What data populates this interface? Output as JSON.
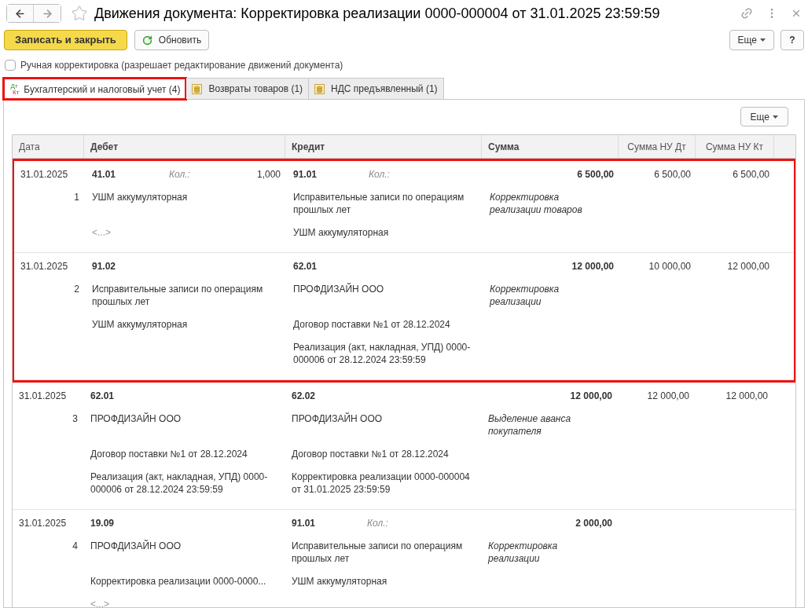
{
  "window": {
    "title": "Движения документа: Корректировка реализации 0000-000004 от 31.01.2025 23:59:59"
  },
  "toolbar": {
    "primary": "Записать и закрыть",
    "refresh": "Обновить",
    "more": "Еще",
    "help": "?"
  },
  "manual_edit": {
    "label": "Ручная корректировка (разрешает редактирование движений документа)",
    "checked": false
  },
  "tabs": [
    {
      "kind": "accounts",
      "icon_top": "Дт",
      "icon_bottom": "Кт",
      "label": "Бухгалтерский и налоговый учет (4)",
      "selected": true,
      "highlighted": true
    },
    {
      "kind": "register",
      "label": "Возвраты товаров (1)",
      "selected": false,
      "highlighted": false
    },
    {
      "kind": "register",
      "label": "НДС предъявленный (1)",
      "selected": false,
      "highlighted": false
    }
  ],
  "panel_more": "Еще",
  "table": {
    "columns": [
      "Дата",
      "Дебет",
      "Кредит",
      "Сумма",
      "Сумма НУ Дт",
      "Сумма НУ Кт"
    ],
    "entries": [
      {
        "date": "31.01.2025",
        "number": "1",
        "highlighted": true,
        "debit": {
          "account": "41.01",
          "qty_label": "Кол.:",
          "qty": "1,000"
        },
        "credit": {
          "account": "91.01",
          "qty_label": "Кол.:"
        },
        "amount": "6 500,00",
        "nu_dt": "6 500,00",
        "nu_kt": "6 500,00",
        "lines": [
          {
            "debit": "УШМ аккумуляторная",
            "credit": "Исправительные записи по операциям прошлых лет",
            "note": "Корректировка реализации товаров"
          },
          {
            "debit": "<...>",
            "debit_muted": true,
            "credit": "УШМ аккумуляторная"
          }
        ]
      },
      {
        "date": "31.01.2025",
        "number": "2",
        "highlighted": true,
        "debit": {
          "account": "91.02"
        },
        "credit": {
          "account": "62.01"
        },
        "amount": "12 000,00",
        "nu_dt": "10 000,00",
        "nu_kt": "12 000,00",
        "lines": [
          {
            "debit": "Исправительные записи по операциям прошлых лет",
            "credit": "ПРОФДИЗАЙН ООО",
            "note": "Корректировка реализации"
          },
          {
            "debit": "УШМ аккумуляторная",
            "credit": "Договор поставки №1 от 28.12.2024"
          },
          {
            "credit": "Реализация (акт, накладная, УПД) 0000-000006 от 28.12.2024 23:59:59"
          }
        ]
      },
      {
        "date": "31.01.2025",
        "number": "3",
        "highlighted": false,
        "debit": {
          "account": "62.01"
        },
        "credit": {
          "account": "62.02"
        },
        "amount": "12 000,00",
        "nu_dt": "12 000,00",
        "nu_kt": "12 000,00",
        "lines": [
          {
            "debit": "ПРОФДИЗАЙН ООО",
            "credit": "ПРОФДИЗАЙН ООО",
            "note": "Выделение аванса покупателя"
          },
          {
            "debit": "Договор поставки №1 от 28.12.2024",
            "credit": "Договор поставки №1 от 28.12.2024"
          },
          {
            "debit": "Реализация (акт, накладная, УПД) 0000-000006 от 28.12.2024 23:59:59",
            "credit": "Корректировка реализации 0000-000004 от 31.01.2025 23:59:59"
          }
        ]
      },
      {
        "date": "31.01.2025",
        "number": "4",
        "highlighted": false,
        "debit": {
          "account": "19.09"
        },
        "credit": {
          "account": "91.01",
          "qty_label": "Кол.:"
        },
        "amount": "2 000,00",
        "lines": [
          {
            "debit": "ПРОФДИЗАЙН ООО",
            "credit": "Исправительные записи по операциям прошлых лет",
            "note": "Корректировка реализации"
          },
          {
            "debit": "Корректировка реализации 0000-0000...",
            "credit": "УШМ аккумуляторная"
          },
          {
            "debit": "<...>",
            "debit_muted": true
          }
        ]
      }
    ]
  }
}
